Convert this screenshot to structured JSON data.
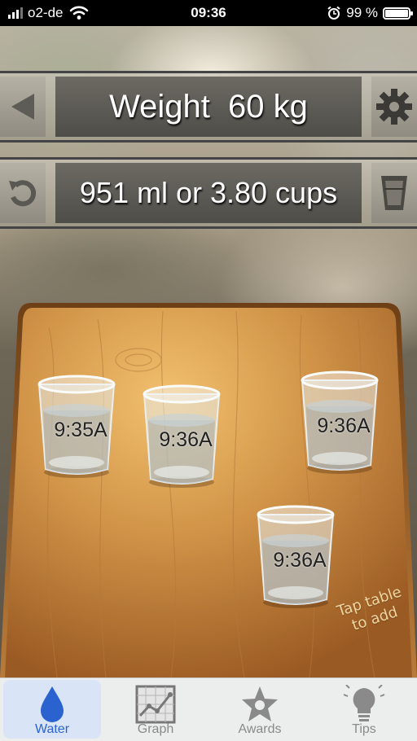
{
  "status_bar": {
    "carrier": "o2-de",
    "time": "09:36",
    "battery": "99 %",
    "battery_level": 0.99
  },
  "weight_bar": {
    "label": "Weight  60 kg",
    "left_icon": "triangle-left-icon",
    "right_icon": "gear-icon"
  },
  "intake_bar": {
    "label": "951 ml or 3.80 cups",
    "left_icon": "undo-icon",
    "right_icon": "cup-icon"
  },
  "glasses": [
    {
      "time": "9:35A"
    },
    {
      "time": "9:36A"
    },
    {
      "time": "9:36A"
    },
    {
      "time": "9:36A"
    }
  ],
  "table_hint": {
    "line1": "Tap table",
    "line2": "to add"
  },
  "tabs": [
    {
      "label": "Water",
      "icon": "water-drop-icon",
      "selected": true
    },
    {
      "label": "Graph",
      "icon": "graph-icon",
      "selected": false
    },
    {
      "label": "Awards",
      "icon": "star-icon",
      "selected": false
    },
    {
      "label": "Tips",
      "icon": "lightbulb-icon",
      "selected": false
    }
  ],
  "colors": {
    "accent": "#2a63cf",
    "table_wood": "#c98d45"
  }
}
